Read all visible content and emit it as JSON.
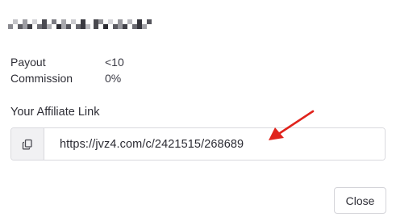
{
  "details": [
    {
      "label": "Payout",
      "value": "<10"
    },
    {
      "label": "Commission",
      "value": "0%"
    }
  ],
  "affiliate": {
    "label": "Your Affiliate Link",
    "url": "https://jvz4.com/c/2421515/268689",
    "copy_icon": "copy-icon"
  },
  "annotation": {
    "arrow_color": "#e0231c"
  },
  "actions": {
    "close_label": "Close"
  }
}
